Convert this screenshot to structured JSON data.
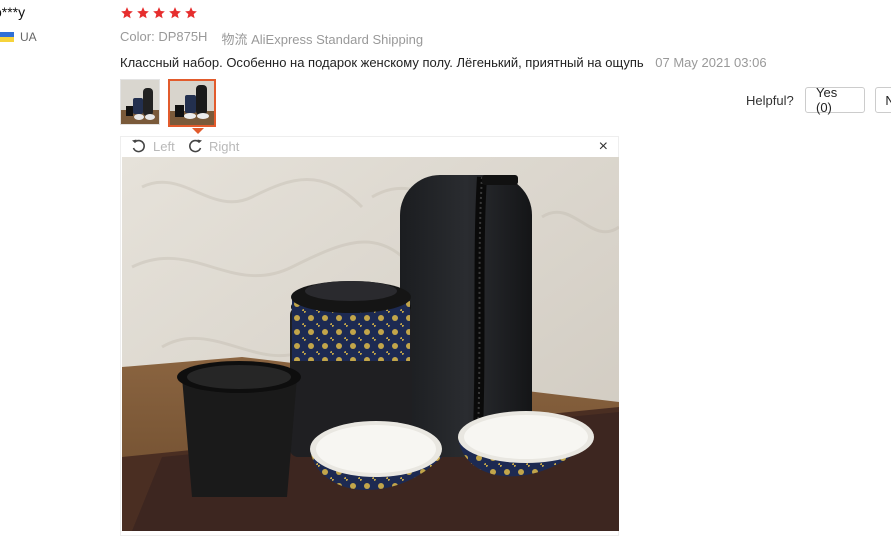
{
  "reviewer": {
    "name": "o***y",
    "country": "UA"
  },
  "rating": {
    "stars": 5,
    "color": "#e62e2e"
  },
  "meta": {
    "color_label": "Color:",
    "color_value": "DP875H",
    "shipping_label": "物流",
    "shipping_value": "AliExpress Standard Shipping"
  },
  "review": {
    "text": "Классный набор. Особенно на подарок женскому полу. Лёгенький, приятный на ощупь",
    "time": "07 May 2021 03:06"
  },
  "helpful": {
    "label": "Helpful?",
    "yes": "Yes (0)",
    "no": "N"
  },
  "viewer": {
    "left_label": "Left",
    "right_label": "Right",
    "close": "×"
  },
  "icons": [
    "star-icon",
    "rotate-left-icon",
    "rotate-right-icon",
    "close-icon",
    "flag-icon"
  ]
}
